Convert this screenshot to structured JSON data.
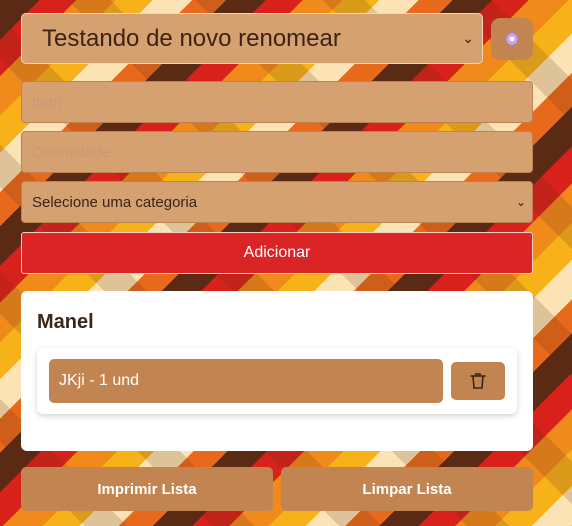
{
  "list_selector": {
    "value": "Testando de novo renomear"
  },
  "settings": {
    "icon": "gear-icon"
  },
  "form": {
    "item_placeholder": "Item",
    "quantity_placeholder": "Quantidade",
    "category_value": "Selecione uma categoria",
    "add_label": "Adicionar"
  },
  "list": {
    "category_title": "Manel",
    "items": [
      {
        "label": "JKji - 1 und",
        "delete_icon": "trash-icon"
      }
    ]
  },
  "actions": {
    "print_label": "Imprimir Lista",
    "clear_label": "Limpar Lista"
  },
  "colors": {
    "accent_red": "#db2426",
    "tan": "#c28552",
    "field_bg": "#d6a170"
  }
}
